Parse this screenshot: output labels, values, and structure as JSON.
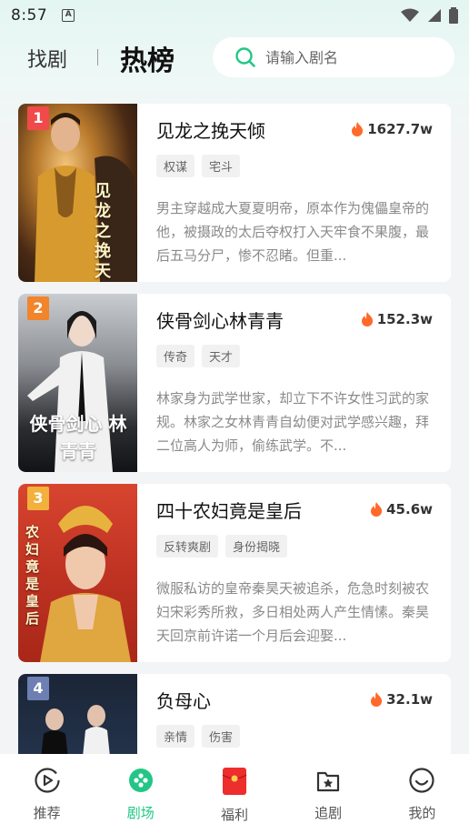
{
  "status": {
    "time": "8:57",
    "notif_glyph": "A"
  },
  "header": {
    "tab_find": "找剧",
    "tab_hot": "热榜",
    "search_placeholder": "请输入剧名"
  },
  "colors": {
    "accent": "#23c686",
    "heat": "#ff6a2b",
    "rank1": "#f04a4a",
    "rank2": "#f2842b",
    "rank3": "#f2b03c",
    "rank4": "#6d7fb3"
  },
  "dramas": [
    {
      "rank": "1",
      "title": "见龙之挽天倾",
      "heat": "1627.7w",
      "tags": [
        "权谋",
        "宅斗"
      ],
      "desc": "男主穿越成大夏夏明帝，原本作为傀儡皇帝的他，被摄政的太后夺权打入天牢食不果腹，最后五马分尸，惨不忍睹。但重...",
      "poster_text": "见龙之挽天倾"
    },
    {
      "rank": "2",
      "title": "侠骨剑心林青青",
      "heat": "152.3w",
      "tags": [
        "传奇",
        "天才"
      ],
      "desc": "林家身为武学世家，却立下不许女性习武的家规。林家之女林青青自幼便对武学感兴趣，拜二位高人为师，偷练武学。不...",
      "poster_text": "侠骨剑心 林青青"
    },
    {
      "rank": "3",
      "title": "四十农妇竟是皇后",
      "heat": "45.6w",
      "tags": [
        "反转爽剧",
        "身份揭晓"
      ],
      "desc": "微服私访的皇帝秦昊天被追杀，危急时刻被农妇宋彩秀所救，多日相处两人产生情愫。秦昊天回京前许诺一个月后会迎娶...",
      "poster_text": "农妇 竟是皇后"
    },
    {
      "rank": "4",
      "title": "负母心",
      "heat": "32.1w",
      "tags": [
        "亲情",
        "伤害"
      ],
      "desc": "",
      "poster_text": ""
    }
  ],
  "nav": [
    {
      "label": "推荐",
      "icon": "play-circle-icon"
    },
    {
      "label": "剧场",
      "icon": "theater-icon"
    },
    {
      "label": "福利",
      "icon": "red-envelope-icon"
    },
    {
      "label": "追剧",
      "icon": "star-folder-icon"
    },
    {
      "label": "我的",
      "icon": "smile-icon"
    }
  ]
}
